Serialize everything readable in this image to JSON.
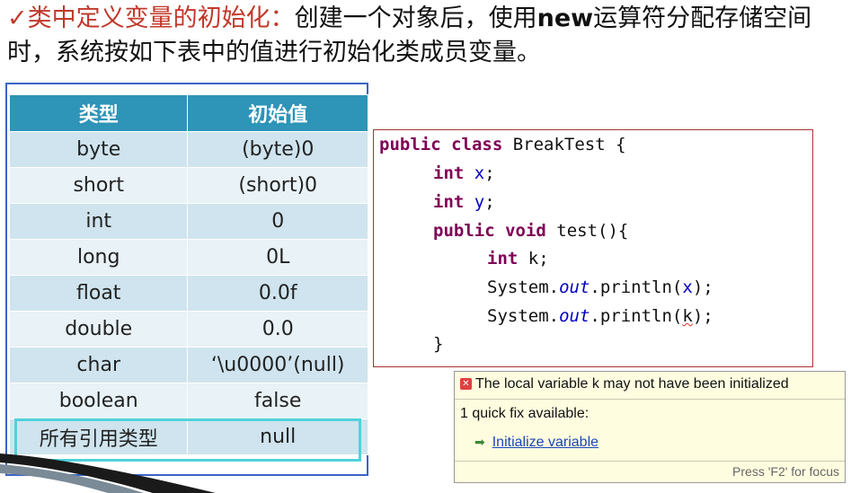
{
  "heading": {
    "check_mark": "✓",
    "title_red": "类中定义变量的初始化：",
    "text_part1": "创建一个对象后，使用",
    "text_bold": "new",
    "text_part2": "运算符分配存储空间时，系统按如下表中的值进行初始化类成员变量。"
  },
  "table": {
    "headers": [
      "类型",
      "初始值"
    ],
    "rows": [
      [
        "byte",
        "(byte)0"
      ],
      [
        "short",
        "(short)0"
      ],
      [
        "int",
        "0"
      ],
      [
        "long",
        "0L"
      ],
      [
        "float",
        "0.0f"
      ],
      [
        "double",
        "0.0"
      ],
      [
        "char",
        "‘\\u0000’(null)"
      ],
      [
        "boolean",
        "false"
      ],
      [
        "所有引用类型",
        "null"
      ]
    ]
  },
  "code": {
    "line1": {
      "kw": "public class",
      "rest": " BreakTest {"
    },
    "line2": {
      "kw": "int",
      "field": "x",
      "end": ";"
    },
    "line3": {
      "kw": "int",
      "field": "y",
      "end": ";"
    },
    "line4": {
      "kw": "public void",
      "rest": " test(){"
    },
    "line5": {
      "kw": "int",
      "rest": " k;"
    },
    "line6": {
      "pre": "System.",
      "static": "out",
      "mid": ".println(",
      "arg": "x",
      "end": ");"
    },
    "line7": {
      "pre": "System.",
      "static": "out",
      "mid": ".println(",
      "arg": "k",
      "end": ");"
    },
    "line8": "}"
  },
  "tooltip": {
    "message": "The local variable k may not have been initialized",
    "fix_count": "1 quick fix available:",
    "fix_label": "Initialize variable",
    "footer": "Press 'F2' for focus"
  },
  "colors": {
    "header_bg": "#2e94b8",
    "row_odd": "#cfe4ee",
    "row_even": "#e8f2f7",
    "frame": "#3a64c8",
    "highlight": "#4fd2d9",
    "keyword": "#7f0055",
    "field": "#0000c0",
    "accent_red": "#c0392b"
  }
}
